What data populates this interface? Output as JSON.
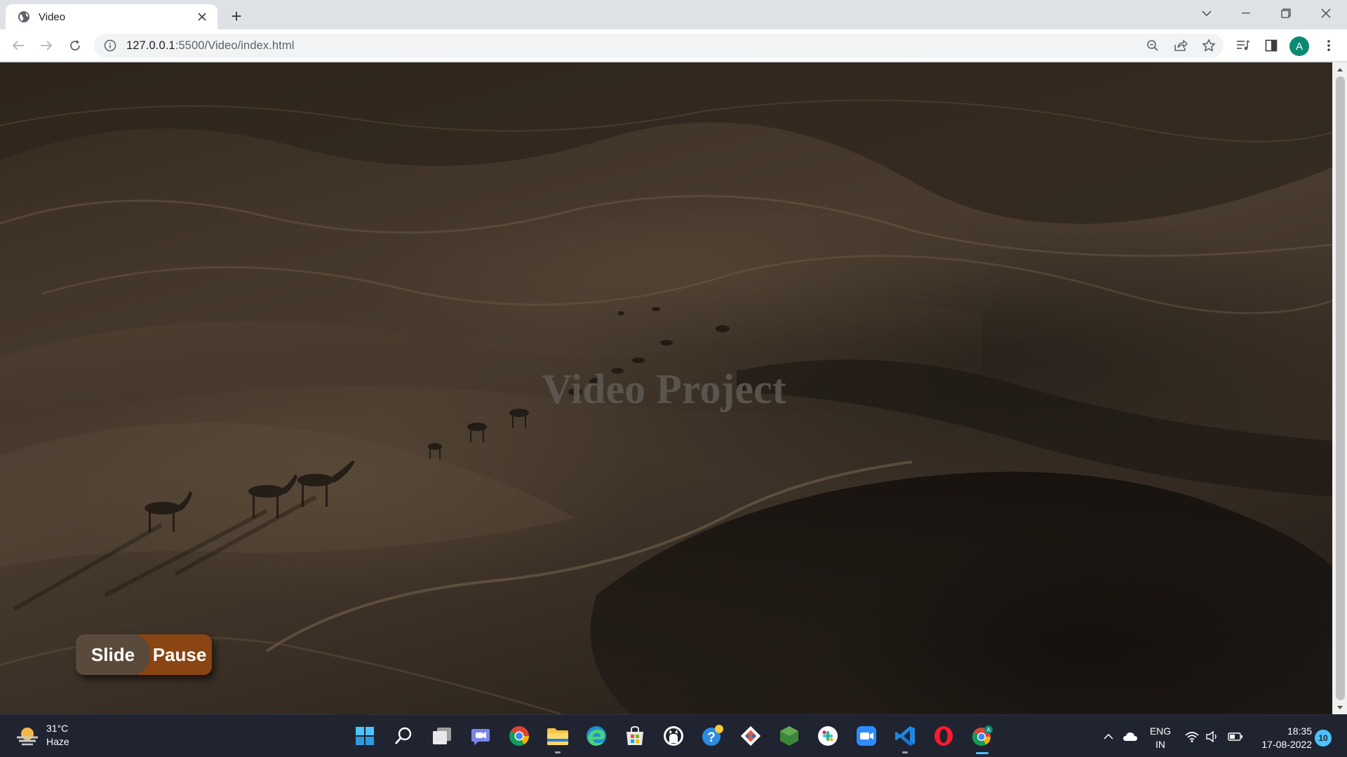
{
  "browser": {
    "tab": {
      "title": "Video",
      "favicon": "globe-icon"
    },
    "new_tab_symbol": "+",
    "window_controls": [
      "tab-search",
      "minimize",
      "restore",
      "close"
    ],
    "url": {
      "host": "127.0.0.1",
      "path": ":5500/Video/index.html"
    },
    "profile_initial": "A"
  },
  "page": {
    "title": "Video Project",
    "buttons": {
      "slide": "Slide",
      "pause": "Pause"
    },
    "colors": {
      "slide_button": "#5a4a3c",
      "pause_button": "#8a4513"
    }
  },
  "taskbar": {
    "weather": {
      "temp": "31°C",
      "condition": "Haze"
    },
    "apps": [
      "windows-start",
      "search",
      "task-view",
      "teams-chat",
      "chrome",
      "file-explorer",
      "edge",
      "microsoft-store",
      "github",
      "help",
      "git",
      "node",
      "slack",
      "zoom",
      "vscode",
      "opera",
      "chrome-profile"
    ],
    "language": {
      "line1": "ENG",
      "line2": "IN"
    },
    "clock": {
      "time": "18:35",
      "date": "17-08-2022"
    },
    "notifications": "10",
    "accent": "#4cc2ff"
  }
}
